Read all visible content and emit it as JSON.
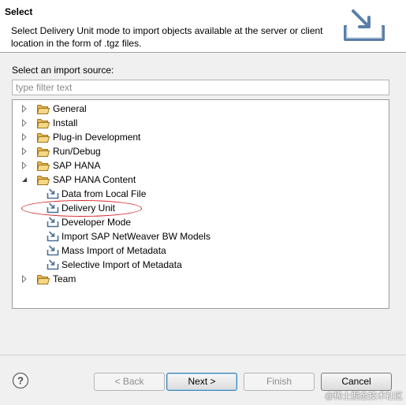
{
  "header": {
    "title": "Select",
    "description": "Select Delivery Unit mode to import objects available at the server or client location in the form of .tgz files.",
    "icon": "import-wizard-icon"
  },
  "import_source": {
    "label": "Select an import source:",
    "filter_placeholder": "type filter text",
    "filter_value": ""
  },
  "tree": {
    "items": [
      {
        "label": "General",
        "type": "folder",
        "expanded": false
      },
      {
        "label": "Install",
        "type": "folder",
        "expanded": false
      },
      {
        "label": "Plug-in Development",
        "type": "folder",
        "expanded": false
      },
      {
        "label": "Run/Debug",
        "type": "folder",
        "expanded": false
      },
      {
        "label": "SAP HANA",
        "type": "folder",
        "expanded": false
      },
      {
        "label": "SAP HANA Content",
        "type": "folder",
        "expanded": true
      },
      {
        "label": "Data from Local File",
        "type": "leaf"
      },
      {
        "label": "Delivery Unit",
        "type": "leaf",
        "highlighted": true
      },
      {
        "label": "Developer Mode",
        "type": "leaf"
      },
      {
        "label": "Import SAP NetWeaver BW Models",
        "type": "leaf"
      },
      {
        "label": "Mass Import of Metadata",
        "type": "leaf"
      },
      {
        "label": "Selective Import of Metadata",
        "type": "leaf"
      },
      {
        "label": "Team",
        "type": "folder",
        "expanded": false
      }
    ]
  },
  "buttons": {
    "help": "?",
    "back": "< Back",
    "next": "Next >",
    "finish": "Finish",
    "cancel": "Cancel"
  },
  "watermark": "@稀土掘金技术社区",
  "colors": {
    "highlight_ellipse": "#d3232a",
    "folder": "#e8b84a",
    "default_button_border": "#3c7fb1"
  }
}
